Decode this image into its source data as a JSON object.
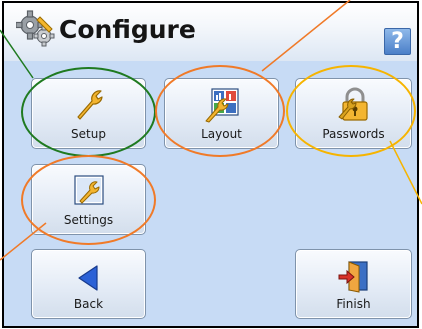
{
  "window": {
    "title": "Configure",
    "help_label": "?"
  },
  "buttons": {
    "setup": "Setup",
    "layout": "Layout",
    "passwords": "Passwords",
    "settings": "Settings",
    "back": "Back",
    "finish": "Finish"
  },
  "colors": {
    "screen_bg": "#c7dbf5",
    "highlight_green": "#1f7a20",
    "highlight_orange": "#f07a28",
    "highlight_yellow": "#f6b400"
  },
  "icons": {
    "title": "gear-icon",
    "setup": "wrench-icon",
    "layout": "layout-grid-wrench-icon",
    "passwords": "padlock-wrench-icon",
    "settings": "wrench-document-icon",
    "back": "back-arrow-icon",
    "finish": "exit-door-icon",
    "help": "help-icon"
  }
}
